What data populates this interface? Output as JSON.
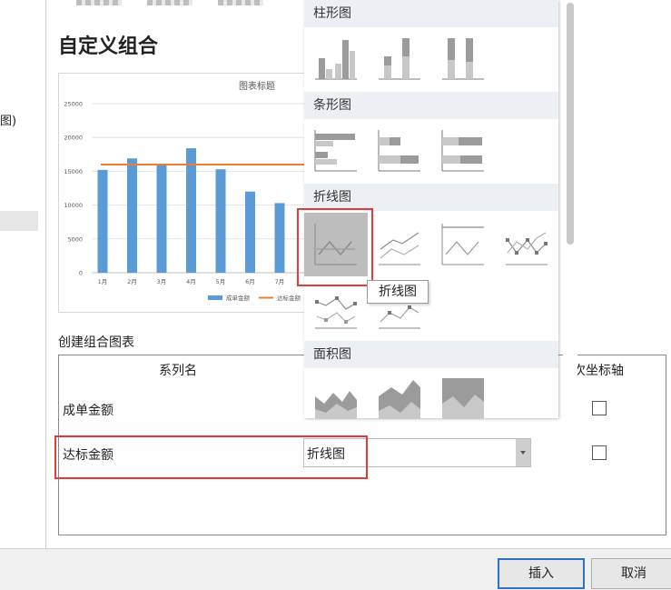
{
  "left_panel": {
    "fragment_text": "图)"
  },
  "dialog": {
    "title": "自定义组合",
    "combo_label": "创建组合图表",
    "table": {
      "col_series": "系列名",
      "col_axis": "次坐标轴",
      "rows": [
        {
          "name": "成单金额",
          "secondary_axis": false
        },
        {
          "name": "达标金额",
          "secondary_axis": false,
          "chart_type": "折线图"
        }
      ]
    },
    "buttons": {
      "insert": "插入",
      "cancel": "取消"
    }
  },
  "gallery": {
    "sections": [
      "柱形图",
      "条形图",
      "折线图",
      "面积图"
    ],
    "tooltip": "折线图",
    "selected": "折线图"
  },
  "chart_data": {
    "type": "bar",
    "title": "图表标题",
    "categories": [
      "1月",
      "2月",
      "3月",
      "4月",
      "5月",
      "6月",
      "7月"
    ],
    "series": [
      {
        "name": "成单金额",
        "type": "bar",
        "values": [
          15200,
          16900,
          16000,
          18400,
          15300,
          12000,
          10300
        ]
      },
      {
        "name": "达标金额",
        "type": "line",
        "values": [
          16000,
          16000,
          16000,
          16000,
          16000,
          16000,
          16000
        ]
      }
    ],
    "yticks": [
      "0",
      "5000",
      "10000",
      "15000",
      "20000",
      "25000"
    ],
    "ylim": [
      0,
      25000
    ],
    "colors": {
      "bar": "#5b9bd5",
      "line": "#ed7d31"
    },
    "legend": "bottom"
  }
}
